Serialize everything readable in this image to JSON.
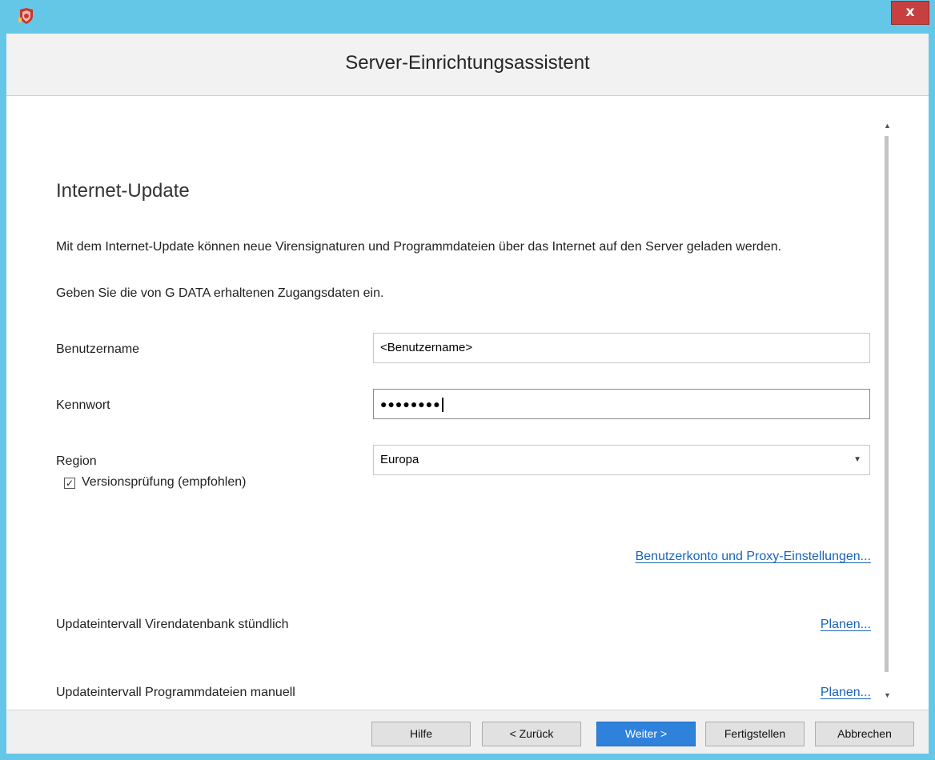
{
  "window": {
    "app_icon": "gdata-shield-icon",
    "close_label": "x"
  },
  "header": {
    "title": "Server-Einrichtungsassistent"
  },
  "page": {
    "section_title": "Internet-Update",
    "intro": "Mit dem Internet-Update können neue Virensignaturen und Programmdateien über das Internet auf den Server geladen werden.",
    "hint": "Geben Sie die von G DATA erhaltenen Zugangsdaten ein."
  },
  "form": {
    "username_label": "Benutzername",
    "username_value": "<Benutzername>",
    "password_label": "Kennwort",
    "password_value": "●●●●●●●●",
    "region_label": "Region",
    "region_value": "Europa",
    "version_check_label": "Versionsprüfung (empfohlen)",
    "version_check_checked": true,
    "proxy_link": "Benutzerkonto und Proxy-Einstellungen..."
  },
  "schedule": {
    "virus_db_label": "Updateintervall Virendatenbank stündlich",
    "virus_db_link": "Planen...",
    "program_files_label": "Updateintervall Programmdateien manuell",
    "program_files_link": "Planen..."
  },
  "footer": {
    "help": "Hilfe",
    "back": "< Zurück",
    "next": "Weiter >",
    "finish": "Fertigstellen",
    "cancel": "Abbrechen"
  },
  "colors": {
    "titlebar": "#65c7e8",
    "close_button": "#c74040",
    "primary_button": "#2f82dc",
    "link": "#1a64b8"
  }
}
